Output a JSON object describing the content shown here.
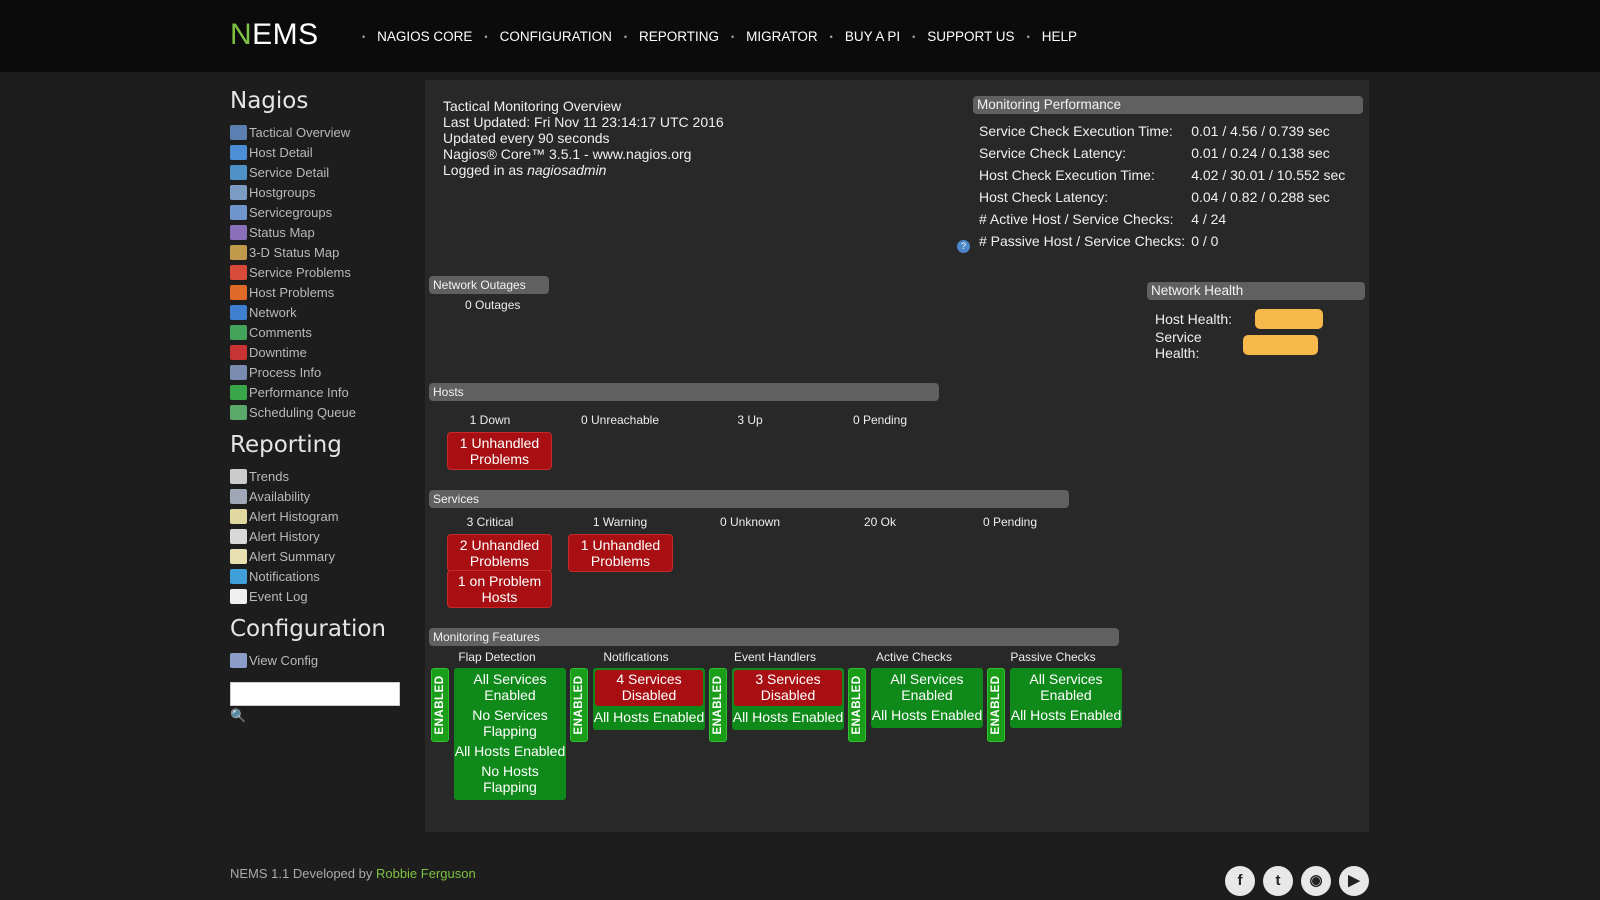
{
  "brand": {
    "first": "N",
    "rest": "EMS"
  },
  "topnav": [
    "NAGIOS CORE",
    "CONFIGURATION",
    "REPORTING",
    "MIGRATOR",
    "BUY A PI",
    "SUPPORT US",
    "HELP"
  ],
  "sidebar": {
    "nagios_title": "Nagios",
    "nagios_items": [
      {
        "label": "Tactical Overview",
        "icon": "monitor-icon",
        "color": "#5b7fb0"
      },
      {
        "label": "Host Detail",
        "icon": "computer-icon",
        "color": "#4d8fd6"
      },
      {
        "label": "Service Detail",
        "icon": "gear-icon",
        "color": "#4f92c7"
      },
      {
        "label": "Hostgroups",
        "icon": "hostgroup-icon",
        "color": "#7c9cc6"
      },
      {
        "label": "Servicegroups",
        "icon": "servicegroup-icon",
        "color": "#6f96cc"
      },
      {
        "label": "Status Map",
        "icon": "map-icon",
        "color": "#8a70b8"
      },
      {
        "label": "3-D Status Map",
        "icon": "3d-map-icon",
        "color": "#c09a4a"
      },
      {
        "label": "Service Problems",
        "icon": "service-problem-icon",
        "color": "#d84a3a"
      },
      {
        "label": "Host Problems",
        "icon": "host-problem-icon",
        "color": "#e06a28"
      },
      {
        "label": "Network",
        "icon": "network-icon",
        "color": "#3f7fcf"
      },
      {
        "label": "Comments",
        "icon": "comments-icon",
        "color": "#44a35a"
      },
      {
        "label": "Downtime",
        "icon": "downtime-icon",
        "color": "#c83434"
      },
      {
        "label": "Process Info",
        "icon": "process-icon",
        "color": "#7a8db0"
      },
      {
        "label": "Performance Info",
        "icon": "performance-icon",
        "color": "#3aa64a"
      },
      {
        "label": "Scheduling Queue",
        "icon": "schedule-icon",
        "color": "#5aa86a"
      }
    ],
    "reporting_title": "Reporting",
    "reporting_items": [
      {
        "label": "Trends",
        "icon": "trends-icon",
        "color": "#cccccc"
      },
      {
        "label": "Availability",
        "icon": "availability-icon",
        "color": "#a0a8b8"
      },
      {
        "label": "Alert Histogram",
        "icon": "histogram-icon",
        "color": "#e0d8a0"
      },
      {
        "label": "Alert History",
        "icon": "history-icon",
        "color": "#d8d8d8"
      },
      {
        "label": "Alert Summary",
        "icon": "summary-icon",
        "color": "#e8e0b0"
      },
      {
        "label": "Notifications",
        "icon": "notifications-icon",
        "color": "#3f9fd8"
      },
      {
        "label": "Event Log",
        "icon": "event-log-icon",
        "color": "#f0f0f0"
      }
    ],
    "config_title": "Configuration",
    "config_items": [
      {
        "label": "View Config",
        "icon": "config-icon",
        "color": "#8c9cc8"
      }
    ],
    "search_value": ""
  },
  "info": {
    "title": "Tactical Monitoring Overview",
    "updated": "Last Updated: Fri Nov 11 23:14:17 UTC 2016",
    "interval": "Updated every 90 seconds",
    "version": "Nagios® Core™ 3.5.1 - www.nagios.org",
    "logged_prefix": "Logged in as ",
    "user": "nagiosadmin"
  },
  "perf": {
    "title": "Monitoring Performance",
    "rows": [
      {
        "label": "Service Check Execution Time:",
        "value": "0.01 / 4.56 / 0.739 sec"
      },
      {
        "label": "Service Check Latency:",
        "value": "0.01 / 0.24 / 0.138 sec"
      },
      {
        "label": "Host Check Execution Time:",
        "value": "4.02 / 30.01 / 10.552 sec"
      },
      {
        "label": "Host Check Latency:",
        "value": "0.04 / 0.82 / 0.288 sec"
      },
      {
        "label": "# Active Host / Service Checks:",
        "value": "4 / 24"
      },
      {
        "label": "# Passive Host / Service Checks:",
        "value": "0 / 0"
      }
    ]
  },
  "health": {
    "title": "Network Health",
    "host_label": "Host Health:",
    "host_level": 0.75,
    "service_label": "Service Health:",
    "service_level": 0.83,
    "color": "#f7b94c"
  },
  "outages": {
    "title": "Network Outages",
    "text": "0 Outages"
  },
  "hosts": {
    "title": "Hosts",
    "stats": [
      "1 Down",
      "0 Unreachable",
      "3 Up",
      "0 Pending"
    ],
    "problem": "1 Unhandled Problems"
  },
  "services": {
    "title": "Services",
    "stats": [
      "3 Critical",
      "1 Warning",
      "0 Unknown",
      "20 Ok",
      "0 Pending"
    ],
    "critical_unhandled": "2 Unhandled Problems",
    "critical_on_problem": "1 on Problem Hosts",
    "warning_unhandled": "1 Unhandled Problems"
  },
  "features": {
    "title": "Monitoring Features",
    "enabled_label": "ENABLED",
    "columns": [
      {
        "title": "Flap Detection",
        "items": [
          {
            "text": "All Services Enabled",
            "state": "ok"
          },
          {
            "text": "No Services Flapping",
            "state": "ok"
          },
          {
            "text": "All Hosts Enabled",
            "state": "ok"
          },
          {
            "text": "No Hosts Flapping",
            "state": "ok"
          }
        ]
      },
      {
        "title": "Notifications",
        "items": [
          {
            "text": "4 Services Disabled",
            "state": "bad"
          },
          {
            "text": "All Hosts Enabled",
            "state": "ok"
          }
        ]
      },
      {
        "title": "Event Handlers",
        "items": [
          {
            "text": "3 Services Disabled",
            "state": "bad"
          },
          {
            "text": "All Hosts Enabled",
            "state": "ok"
          }
        ]
      },
      {
        "title": "Active Checks",
        "items": [
          {
            "text": "All Services Enabled",
            "state": "ok"
          },
          {
            "text": "All Hosts Enabled",
            "state": "ok"
          }
        ]
      },
      {
        "title": "Passive Checks",
        "items": [
          {
            "text": "All Services Enabled",
            "state": "ok"
          },
          {
            "text": "All Hosts Enabled",
            "state": "ok"
          }
        ]
      }
    ]
  },
  "footer": {
    "text": "NEMS 1.1 Developed by ",
    "author": "Robbie Ferguson"
  },
  "social": [
    {
      "icon": "facebook-icon",
      "glyph": "f"
    },
    {
      "icon": "twitter-icon",
      "glyph": "t"
    },
    {
      "icon": "rss-icon",
      "glyph": "◉"
    },
    {
      "icon": "youtube-icon",
      "glyph": "▶"
    }
  ]
}
